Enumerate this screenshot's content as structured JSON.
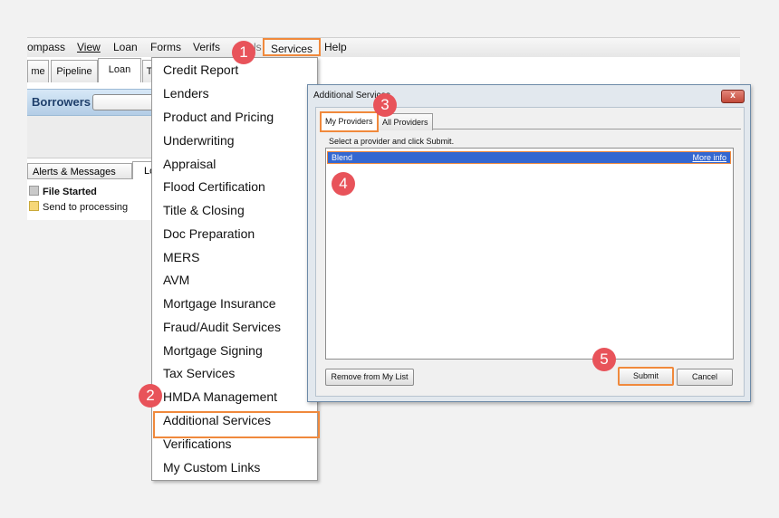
{
  "menubar": {
    "items": [
      "ompass",
      "View",
      "Loan",
      "Forms",
      "Verifs",
      "Services",
      "Help"
    ],
    "hidden_item": "ls"
  },
  "app": {
    "tabs": [
      "me",
      "Pipeline",
      "Loan",
      "T"
    ],
    "section_title": "Borrowers",
    "alerts_tab": "Alerts & Messages",
    "alerts_tab2": "Lo",
    "alerts": [
      "File Started",
      "Send to processing"
    ]
  },
  "services_menu": {
    "items": [
      "Credit Report",
      "Lenders",
      "Product and Pricing",
      "Underwriting",
      "Appraisal",
      "Flood Certification",
      "Title & Closing",
      "Doc Preparation",
      "MERS",
      "AVM",
      "Mortgage Insurance",
      "Fraud/Audit Services",
      "Mortgage Signing",
      "Tax Services",
      "HMDA Management",
      "Additional Services",
      "Verifications",
      "My Custom Links"
    ],
    "highlighted": "Additional Services"
  },
  "dialog": {
    "title": "Additional Services",
    "close_label": "x",
    "tabs": [
      "My Providers",
      "All Providers"
    ],
    "instruction": "Select a provider and click Submit.",
    "providers": [
      {
        "name": "Blend",
        "link": "More info"
      }
    ],
    "buttons": {
      "remove": "Remove from My List",
      "submit": "Submit",
      "cancel": "Cancel"
    }
  },
  "callouts": [
    "1",
    "2",
    "3",
    "4",
    "5"
  ],
  "colors": {
    "highlight": "#f0893c",
    "badge": "#e8535a",
    "selection": "#3467d0"
  }
}
